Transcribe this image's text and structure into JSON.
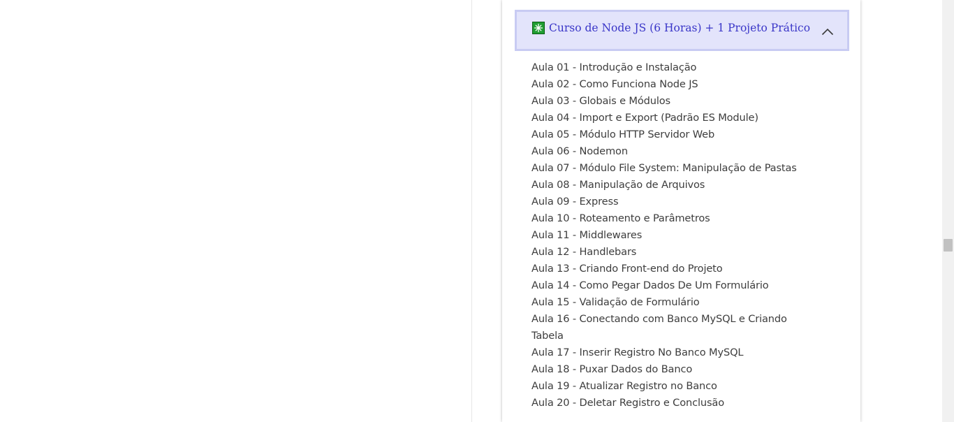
{
  "accordion": {
    "title": "Curso de Node JS (6 Horas) + 1 Projeto Prático",
    "icon": "green-sparkle-icon",
    "expanded": true,
    "colors": {
      "header_bg": "#e3e4fb",
      "header_border": "#c8cbf3",
      "title": "#3a36c8",
      "icon_bg": "#1f9d31",
      "lesson_text": "#3d3d3d"
    },
    "lessons": [
      "Aula 01 - Introdução e Instalação",
      "Aula 02 - Como Funciona Node JS",
      "Aula 03 - Globais e Módulos",
      "Aula 04 - Import e Export (Padrão ES Module)",
      "Aula 05 - Módulo HTTP Servidor Web",
      "Aula 06 - Nodemon",
      "Aula 07 - Módulo File System: Manipulação de Pastas",
      "Aula 08 - Manipulação de Arquivos",
      "Aula 09 - Express",
      "Aula 10 - Roteamento e Parâmetros",
      "Aula 11 - Middlewares",
      "Aula 12 - Handlebars",
      "Aula 13 - Criando Front-end do Projeto",
      "Aula 14 - Como Pegar Dados De Um Formulário",
      "Aula 15 - Validação de Formulário",
      "Aula 16 - Conectando com Banco MySQL e Criando Tabela",
      "Aula 17 - Inserir Registro No Banco MySQL",
      "Aula 18 - Puxar Dados do Banco",
      "Aula 19 - Atualizar Registro no Banco",
      "Aula 20 - Deletar Registro e Conclusão"
    ]
  },
  "scrollbar": {
    "icon": "scrollbar-thumb"
  }
}
